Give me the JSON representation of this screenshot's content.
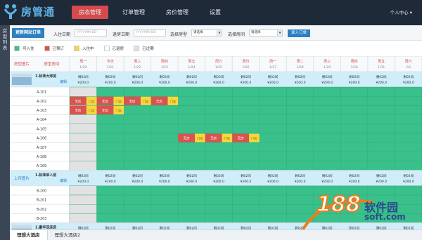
{
  "app": {
    "logo_text": "房管通"
  },
  "nav": [
    {
      "label": "房态管理",
      "active": true
    },
    {
      "label": "订单管理",
      "active": false
    },
    {
      "label": "房价管理",
      "active": false
    },
    {
      "label": "设置",
      "active": false
    }
  ],
  "user_menu": "个人中心 ▾",
  "sidebar": {
    "label": "房型列表"
  },
  "toolbar": {
    "new_order": "更新网站订单",
    "checkin_label": "入住日期",
    "checkin_placeholder": "YYYY-MM-DD",
    "checkout_label": "退房日期",
    "checkout_placeholder": "YYYY-MM-DD",
    "roomtype_label": "选择房型",
    "roomtype_value": "请选择",
    "room_label": "选择房间",
    "room_value": "请选择",
    "entry_button": "录入订单"
  },
  "legend": [
    {
      "label": "可入住",
      "color": "#39c08b"
    },
    {
      "label": "已预订",
      "color": "#d9534f"
    },
    {
      "label": "入住中",
      "color": "#f5d83d"
    },
    {
      "label": "已退房",
      "color": "#ffffff"
    },
    {
      "label": "已过期",
      "color": "#e2e2e2"
    }
  ],
  "grid": {
    "col_headers": [
      "房型图片",
      "房型房间"
    ],
    "days": [
      {
        "wd": "周一",
        "date": "1/20"
      },
      {
        "wd": "今天",
        "date": "1/21"
      },
      {
        "wd": "周三",
        "date": "1/22"
      },
      {
        "wd": "周四",
        "date": "1/23"
      },
      {
        "wd": "周五",
        "date": "1/24"
      },
      {
        "wd": "周六",
        "date": "1/25"
      },
      {
        "wd": "周日",
        "date": "1/26"
      },
      {
        "wd": "周一",
        "date": "1/27"
      },
      {
        "wd": "周二",
        "date": "1/28"
      },
      {
        "wd": "周三",
        "date": "1/29"
      },
      {
        "wd": "周四",
        "date": "1/30"
      },
      {
        "wd": "周五",
        "date": "1/31"
      },
      {
        "wd": "周六",
        "date": "2/1"
      }
    ],
    "status_colors": {
      "free": "#39c08b",
      "booked": "#d9534f",
      "checkin": "#f5d83d",
      "expired": "#e2e2e2",
      "header": "#cfeefa"
    },
    "remain_text": "剩02间",
    "price_text": "¥200.0",
    "booked_label": "无房",
    "door_label": "门店",
    "edit_label": "编辑",
    "upload_label": "上传图片",
    "groups": [
      {
        "name": "1.标准大床房",
        "has_image": true,
        "rooms": [
          {
            "name": "A-101",
            "cells": []
          },
          {
            "name": "A-102",
            "cells": [
              [
                0,
                "b"
              ],
              [
                1,
                "b"
              ],
              [
                2,
                "b"
              ],
              [
                3,
                "b"
              ]
            ]
          },
          {
            "name": "A-103",
            "cells": [
              [
                0,
                "b"
              ],
              [
                1,
                "b"
              ]
            ]
          },
          {
            "name": "A-104",
            "cells": []
          },
          {
            "name": "A-105",
            "cells": []
          },
          {
            "name": "A-106",
            "cells": [
              [
                4,
                "b"
              ],
              [
                5,
                "b"
              ],
              [
                6,
                "b"
              ]
            ]
          },
          {
            "name": "A-107",
            "cells": []
          },
          {
            "name": "A-108",
            "cells": []
          },
          {
            "name": "A-109",
            "cells": []
          }
        ]
      },
      {
        "name": "1.标准单人房",
        "has_image": false,
        "rooms": [
          {
            "name": "B-200",
            "cells": []
          },
          {
            "name": "B-201",
            "cells": []
          },
          {
            "name": "B-202",
            "cells": []
          },
          {
            "name": "B-203",
            "cells": []
          }
        ]
      },
      {
        "name": "1.豪华双床房",
        "has_image": true,
        "rooms": []
      }
    ]
  },
  "watermark": {
    "number": "188",
    "cn": "软件园",
    "url": "soft.com"
  },
  "tabs": [
    {
      "label": "理想大酒店",
      "active": true
    },
    {
      "label": "理想大酒店2",
      "active": false
    }
  ]
}
